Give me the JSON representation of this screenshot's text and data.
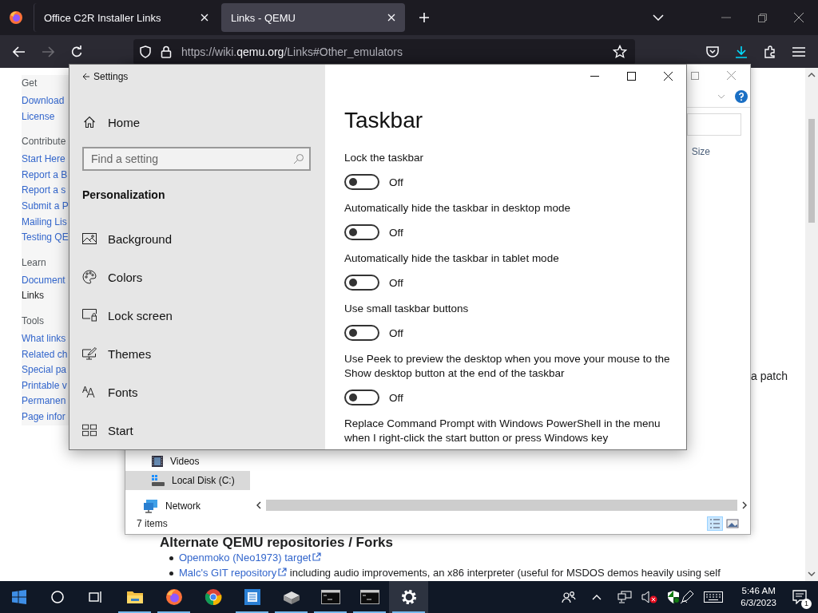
{
  "browser": {
    "tabs": [
      {
        "title": "Office C2R Installer Links",
        "selected": false
      },
      {
        "title": "Links - QEMU",
        "selected": true
      }
    ],
    "url": "https://wiki.**qemu.org**/Links#Other_emulators"
  },
  "wiki": {
    "sidebar": [
      {
        "heading": "Get",
        "links": [
          {
            "label": "Download",
            "selected": false
          },
          {
            "label": "License",
            "selected": false
          }
        ]
      },
      {
        "heading": "Contribute",
        "links": [
          {
            "label": "Start Here",
            "selected": false
          },
          {
            "label": "Report a B",
            "selected": false
          },
          {
            "label": "Report a s",
            "selected": false
          },
          {
            "label": "Submit a P",
            "selected": false
          },
          {
            "label": "Mailing Lis",
            "selected": false
          },
          {
            "label": "Testing QE",
            "selected": false
          }
        ]
      },
      {
        "heading": "Learn",
        "links": [
          {
            "label": "Document",
            "selected": false
          },
          {
            "label": "Links",
            "selected": true
          }
        ]
      },
      {
        "heading": "Tools",
        "links": [
          {
            "label": "What links",
            "selected": false
          },
          {
            "label": "Related ch",
            "selected": false
          },
          {
            "label": "Special pa",
            "selected": false
          },
          {
            "label": "Printable v",
            "selected": false
          },
          {
            "label": "Permanen",
            "selected": false
          },
          {
            "label": "Page infor",
            "selected": false
          }
        ]
      }
    ],
    "side_text": "a patch",
    "section_heading": "Alternate QEMU repositories / Forks",
    "list": [
      {
        "link": "Openmoko (Neo1973) target"
      },
      {
        "link": "Malc's GIT repository",
        "text": "including audio improvements, an x86 interpreter (useful for MSDOS demos heavily using self"
      }
    ]
  },
  "explorer": {
    "column_header": "Size",
    "nav_tree": [
      {
        "children": [
          {
            "label": "Videos",
            "selected": false
          },
          {
            "label": "Local Disk (C:)",
            "selected": true
          }
        ]
      },
      {
        "label": "Network",
        "selected": false
      }
    ],
    "status": "7 items"
  },
  "settings": {
    "title": "Settings",
    "home": "Home",
    "search_placeholder": "Find a setting",
    "section": "Personalization",
    "nav": [
      "Background",
      "Colors",
      "Lock screen",
      "Themes",
      "Fonts",
      "Start"
    ],
    "page_title": "Taskbar",
    "options": [
      {
        "label": "Lock the taskbar",
        "on": false,
        "status": "Off"
      },
      {
        "label": "Automatically hide the taskbar in desktop mode",
        "on": false,
        "status": "Off"
      },
      {
        "label": "Automatically hide the taskbar in tablet mode",
        "on": false,
        "status": "Off"
      },
      {
        "label": "Use small taskbar buttons",
        "on": false,
        "status": "Off"
      },
      {
        "label": "Use Peek to preview the desktop when you move your mouse to the Show desktop button at the end of the taskbar",
        "on": false,
        "status": "Off"
      },
      {
        "label": "Replace Command Prompt with Windows PowerShell in the menu when I right-click the start button or press Windows key"
      }
    ]
  },
  "taskbar": {
    "apps": [
      {
        "running": true,
        "selected": false
      },
      {
        "running": true,
        "selected": false
      },
      {
        "running": false,
        "selected": false
      },
      {
        "running": true,
        "selected": false
      },
      {
        "running": true,
        "selected": false
      },
      {
        "running": true,
        "selected": false
      },
      {
        "running": true,
        "selected": false
      },
      {
        "running": true,
        "selected": true
      }
    ],
    "time": "5:46 AM",
    "date": "6/3/2023",
    "notifications": "1"
  }
}
